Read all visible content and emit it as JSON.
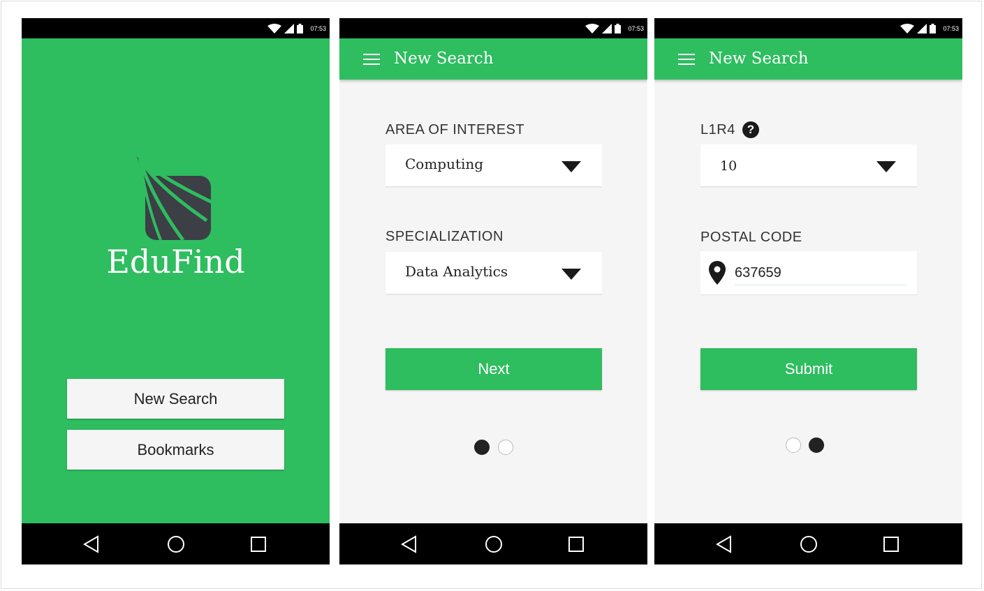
{
  "status_bar": {
    "time": "07:53"
  },
  "screens": [
    {
      "brand": "EduFind",
      "buttons": {
        "new_search": "New Search",
        "bookmarks": "Bookmarks"
      }
    },
    {
      "title": "New Search",
      "fields": [
        {
          "label": "AREA OF INTEREST",
          "value": "Computing"
        },
        {
          "label": "SPECIALIZATION",
          "value": "Data Analytics"
        }
      ],
      "button": "Next",
      "page_indicator": {
        "current": 1,
        "total": 2
      }
    },
    {
      "title": "New Search",
      "l1r4": {
        "label": "L1R4",
        "help_icon": "?",
        "value": "10"
      },
      "postal_code": {
        "label": "POSTAL CODE",
        "value": "637659",
        "icon": "location-pin-icon"
      },
      "button": "Submit",
      "page_indicator": {
        "current": 2,
        "total": 2
      }
    }
  ],
  "colors": {
    "accent": "#2ebd5f",
    "background": "#f5f5f5",
    "bars": "#000000"
  },
  "nav_icons": [
    "back-icon",
    "home-icon",
    "recents-icon"
  ]
}
